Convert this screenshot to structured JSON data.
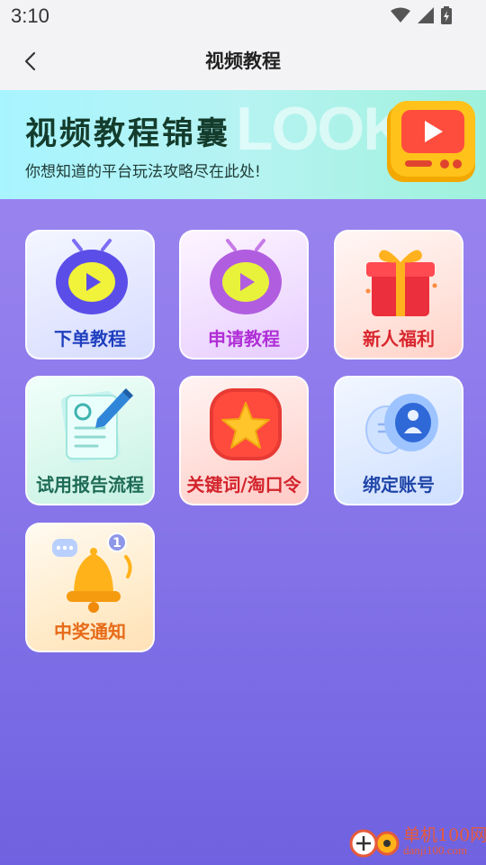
{
  "status_bar": {
    "time": "3:10"
  },
  "nav": {
    "title": "视频教程"
  },
  "banner": {
    "title": "视频教程锦囊",
    "subtitle": "你想知道的平台玩法攻略尽在此处!",
    "decor_text": "LOOK"
  },
  "tiles": [
    {
      "label": "下单教程",
      "color": "#1f3fbf"
    },
    {
      "label": "申请教程",
      "color": "#b02fd6"
    },
    {
      "label": "新人福利",
      "color": "#d9262e"
    },
    {
      "label": "试用报告流程",
      "color": "#1e6b55"
    },
    {
      "label": "关键词/淘口令",
      "color": "#d3242c"
    },
    {
      "label": "绑定账号",
      "color": "#1f45a8"
    },
    {
      "label": "中奖通知",
      "color": "#e66a18"
    }
  ],
  "watermark": {
    "name": "单机100网",
    "url": "danji100.com"
  }
}
